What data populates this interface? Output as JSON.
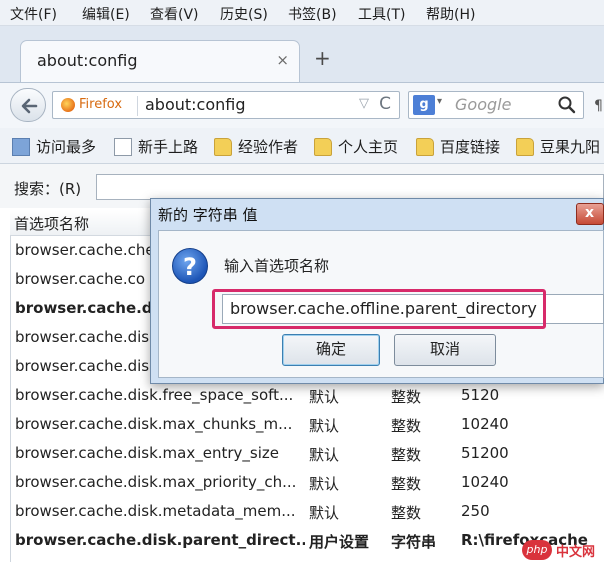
{
  "menubar": {
    "items": [
      "文件(F)",
      "编辑(E)",
      "查看(V)",
      "历史(S)",
      "书签(B)",
      "工具(T)",
      "帮助(H)"
    ]
  },
  "tabs": {
    "active": {
      "label": "about:config",
      "close": "×"
    },
    "new_tab": "+"
  },
  "navbar": {
    "identity_label": "Firefox",
    "url": "about:config",
    "bookmark_star": "▽",
    "reload": "C",
    "search_engine_badge": "g",
    "search_dropdown": "▾",
    "search_placeholder": "Google",
    "overflow": "¶"
  },
  "bookmarks": [
    {
      "label": "访问最多",
      "icon": "star-folder-icon"
    },
    {
      "label": "新手上路",
      "icon": "page-icon"
    },
    {
      "label": "经验作者",
      "icon": "folder-icon"
    },
    {
      "label": "个人主页",
      "icon": "folder-icon"
    },
    {
      "label": "百度链接",
      "icon": "folder-icon"
    },
    {
      "label": "豆果九阳",
      "icon": "folder-icon"
    }
  ],
  "config": {
    "search_label": "搜索：(R)",
    "search_value": "",
    "column_name_header": "首选项名称",
    "rows": [
      {
        "name": "browser.cache.che",
        "status": "",
        "type": "",
        "value": "",
        "bold": false
      },
      {
        "name": "browser.cache.co",
        "status": "",
        "type": "",
        "value": "",
        "bold": false
      },
      {
        "name": "browser.cache.di",
        "status": "",
        "type": "",
        "value": "",
        "bold": true
      },
      {
        "name": "browser.cache.dis",
        "status": "",
        "type": "",
        "value": "",
        "bold": false
      },
      {
        "name": "browser.cache.dis",
        "status": "",
        "type": "",
        "value": "",
        "bold": false
      },
      {
        "name": "browser.cache.disk.free_space_soft...",
        "status": "默认",
        "type": "整数",
        "value": "5120",
        "bold": false
      },
      {
        "name": "browser.cache.disk.max_chunks_m...",
        "status": "默认",
        "type": "整数",
        "value": "10240",
        "bold": false
      },
      {
        "name": "browser.cache.disk.max_entry_size",
        "status": "默认",
        "type": "整数",
        "value": "51200",
        "bold": false
      },
      {
        "name": "browser.cache.disk.max_priority_ch...",
        "status": "默认",
        "type": "整数",
        "value": "10240",
        "bold": false
      },
      {
        "name": "browser.cache.disk.metadata_mem...",
        "status": "默认",
        "type": "整数",
        "value": "250",
        "bold": false
      },
      {
        "name": "browser.cache.disk.parent_direct...",
        "status": "用户设置",
        "type": "字符串",
        "value": "R:\\firefoxcache",
        "bold": true
      }
    ]
  },
  "dialog": {
    "title": "新的 字符串 值",
    "close": "x",
    "prompt": "输入首选项名称",
    "input_value": "browser.cache.offline.parent_directory",
    "ok_label": "确定",
    "cancel_label": "取消",
    "highlight_color": "#d72a6a"
  },
  "watermark": {
    "logo": "php",
    "text": "中文网"
  }
}
